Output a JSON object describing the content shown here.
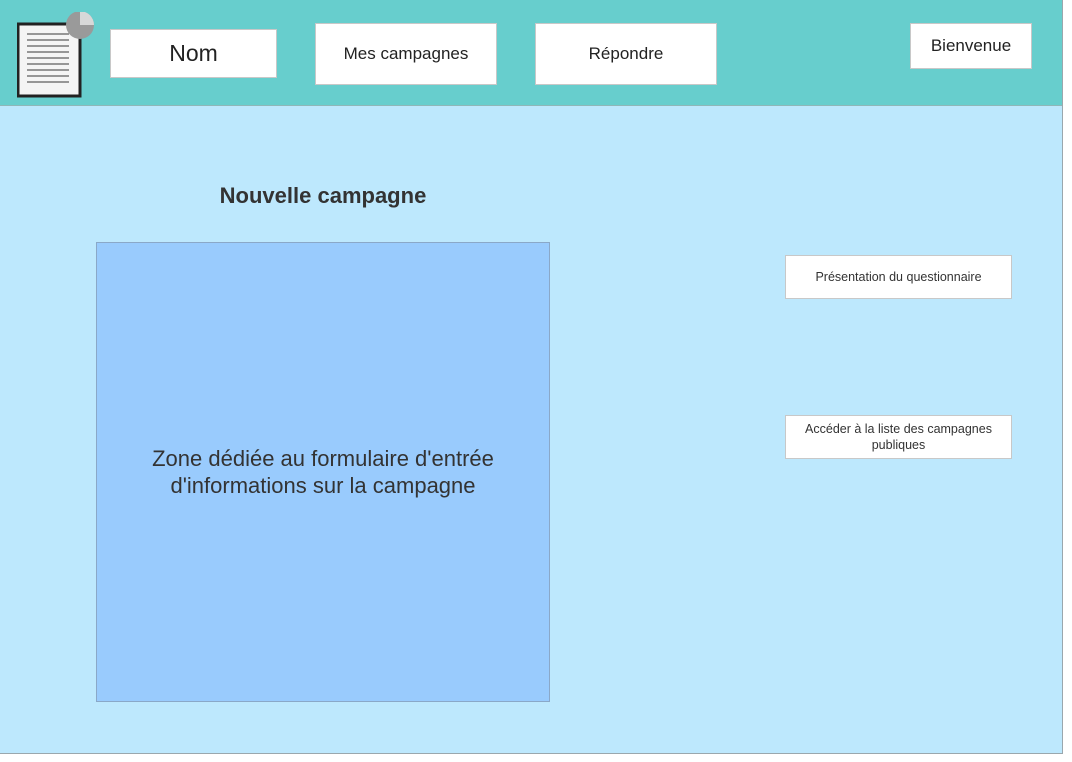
{
  "header": {
    "logo_icon": "document-chart-icon",
    "name_label": "Nom",
    "my_campaigns_label": "Mes campagnes",
    "answer_label": "Répondre",
    "welcome_label": "Bienvenue"
  },
  "main": {
    "title": "Nouvelle campagne",
    "form_zone_text": "Zone dédiée au formulaire d'entrée d'informations sur la campagne"
  },
  "sidebar": {
    "presentation_label": "Présentation du questionnaire",
    "public_list_label": "Accéder à la liste des campagnes publiques"
  },
  "colors": {
    "header_bg": "#67cecd",
    "page_bg": "#bde8fd",
    "form_zone_bg": "#99cbfd"
  }
}
